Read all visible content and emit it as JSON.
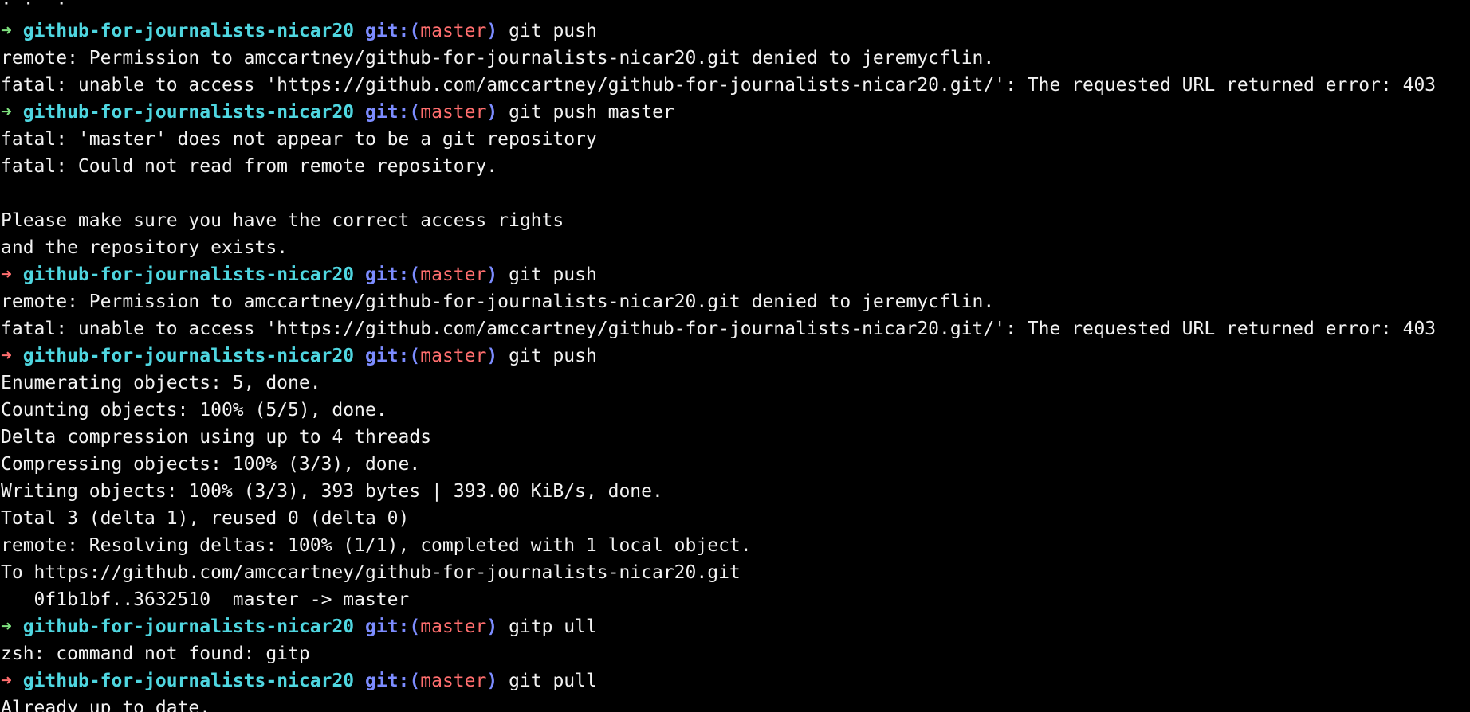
{
  "colors": {
    "background": "#000000",
    "text": "#f2f2f2",
    "arrow_ok": "#7ee07e",
    "arrow_error": "#ff6e6e",
    "directory": "#4fd6e0",
    "git_label": "#7c8cff",
    "branch": "#ff6e6e"
  },
  "prompt": {
    "arrow": "➜",
    "directory": "github-for-journalists-nicar20",
    "git_open": "git:(",
    "branch": "master",
    "git_close": ")"
  },
  "lines": [
    {
      "type": "partial",
      "text": "· ·  ·"
    },
    {
      "type": "prompt",
      "status": "ok",
      "command": "git push"
    },
    {
      "type": "output",
      "text": "remote: Permission to amccartney/github-for-journalists-nicar20.git denied to jeremycflin."
    },
    {
      "type": "output",
      "text": "fatal: unable to access 'https://github.com/amccartney/github-for-journalists-nicar20.git/': The requested URL returned error: 403"
    },
    {
      "type": "prompt",
      "status": "ok",
      "command": "git push master"
    },
    {
      "type": "output",
      "text": "fatal: 'master' does not appear to be a git repository"
    },
    {
      "type": "output",
      "text": "fatal: Could not read from remote repository."
    },
    {
      "type": "output",
      "text": ""
    },
    {
      "type": "output",
      "text": "Please make sure you have the correct access rights"
    },
    {
      "type": "output",
      "text": "and the repository exists."
    },
    {
      "type": "prompt",
      "status": "error",
      "command": "git push"
    },
    {
      "type": "output",
      "text": "remote: Permission to amccartney/github-for-journalists-nicar20.git denied to jeremycflin."
    },
    {
      "type": "output",
      "text": "fatal: unable to access 'https://github.com/amccartney/github-for-journalists-nicar20.git/': The requested URL returned error: 403"
    },
    {
      "type": "prompt",
      "status": "error",
      "command": "git push"
    },
    {
      "type": "output",
      "text": "Enumerating objects: 5, done."
    },
    {
      "type": "output",
      "text": "Counting objects: 100% (5/5), done."
    },
    {
      "type": "output",
      "text": "Delta compression using up to 4 threads"
    },
    {
      "type": "output",
      "text": "Compressing objects: 100% (3/3), done."
    },
    {
      "type": "output",
      "text": "Writing objects: 100% (3/3), 393 bytes | 393.00 KiB/s, done."
    },
    {
      "type": "output",
      "text": "Total 3 (delta 1), reused 0 (delta 0)"
    },
    {
      "type": "output",
      "text": "remote: Resolving deltas: 100% (1/1), completed with 1 local object."
    },
    {
      "type": "output",
      "text": "To https://github.com/amccartney/github-for-journalists-nicar20.git"
    },
    {
      "type": "output",
      "text": "   0f1b1bf..3632510  master -> master"
    },
    {
      "type": "prompt",
      "status": "ok",
      "command": "gitp ull"
    },
    {
      "type": "output",
      "text": "zsh: command not found: gitp"
    },
    {
      "type": "prompt",
      "status": "error",
      "command": "git pull"
    },
    {
      "type": "output",
      "text": "Already up to date."
    }
  ]
}
